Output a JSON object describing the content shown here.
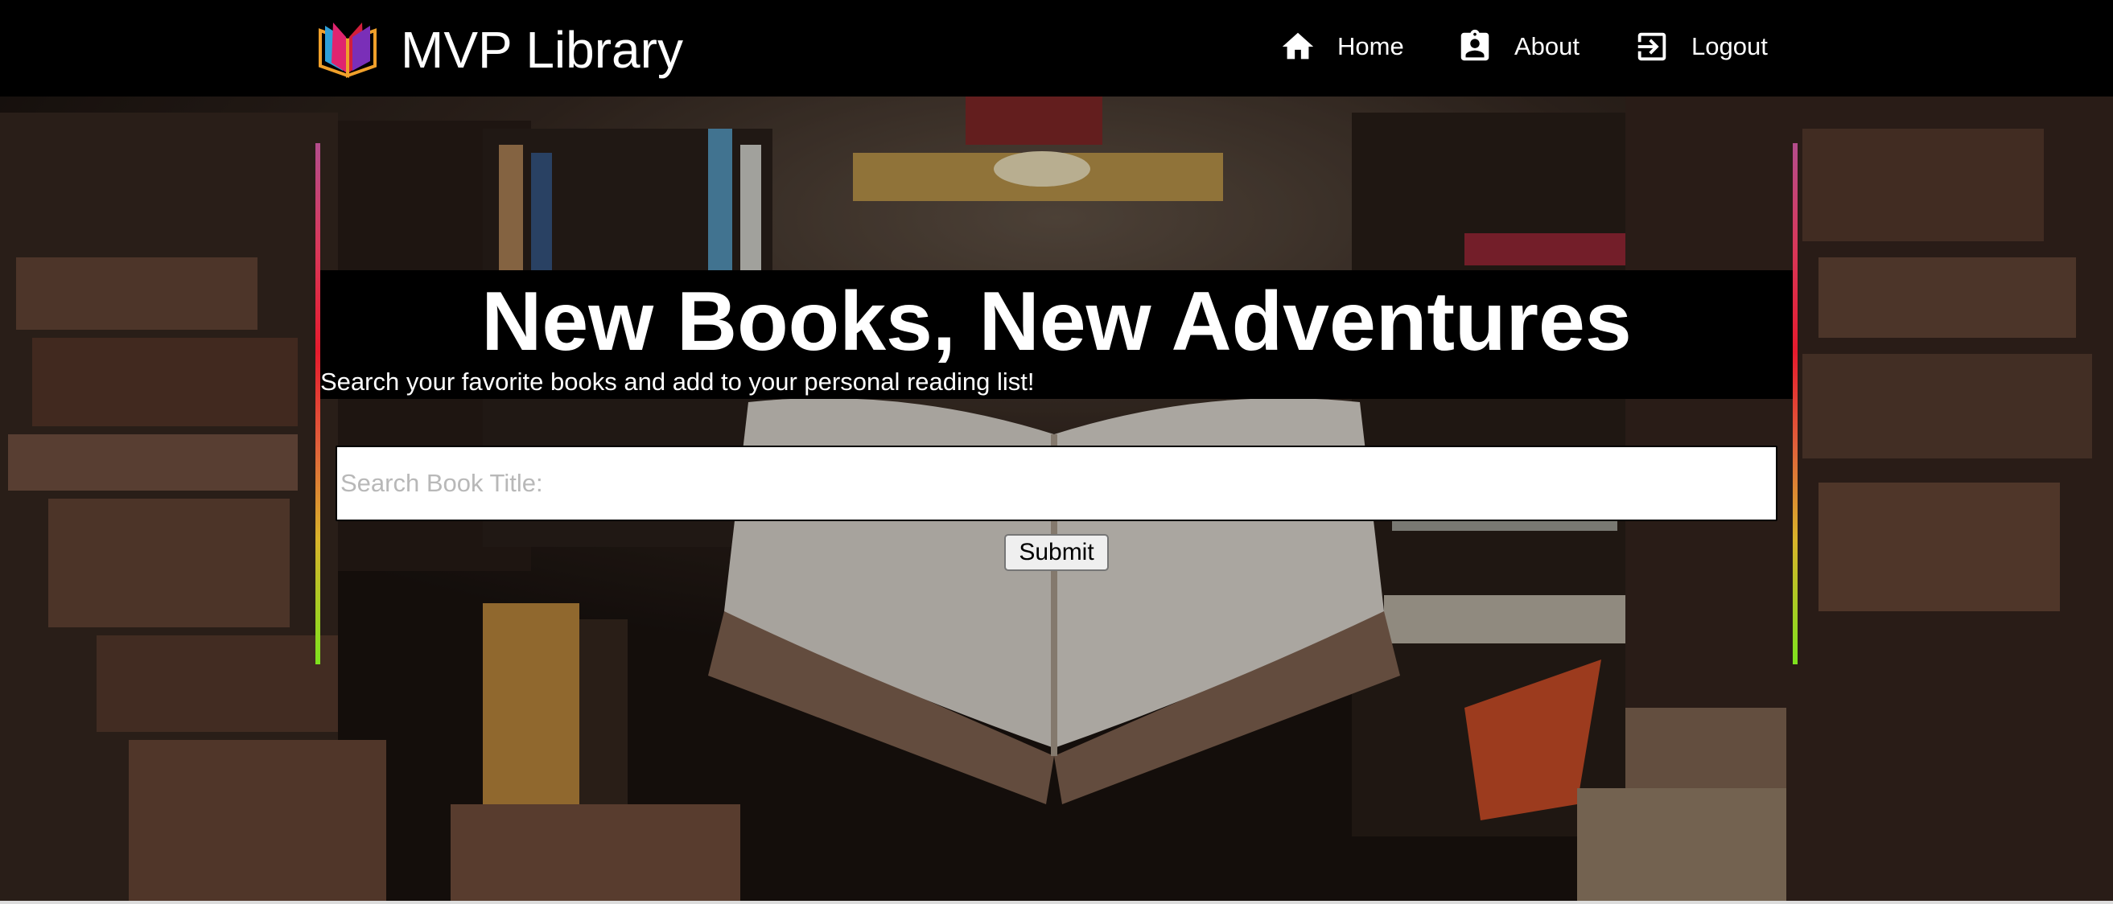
{
  "app": {
    "title": "MVP Library",
    "logo": "open-book-logo"
  },
  "nav": {
    "items": [
      {
        "label": "Home",
        "icon": "home-icon"
      },
      {
        "label": "About",
        "icon": "contact-badge-icon"
      },
      {
        "label": "Logout",
        "icon": "logout-icon"
      }
    ]
  },
  "hero": {
    "title": "New Books, New Adventures",
    "subtitle": "Search your favorite books and add to your personal reading list!",
    "background": "library-bookshelves-open-book-photo",
    "accent_gradient": [
      "#b44d8c",
      "#e61b2d",
      "#d9b32a",
      "#7de21e"
    ]
  },
  "search": {
    "placeholder": "Search Book Title:",
    "value": "",
    "submit_label": "Submit"
  },
  "colors": {
    "navbar": "#000000",
    "banner": "#000000",
    "text": "#ffffff"
  }
}
